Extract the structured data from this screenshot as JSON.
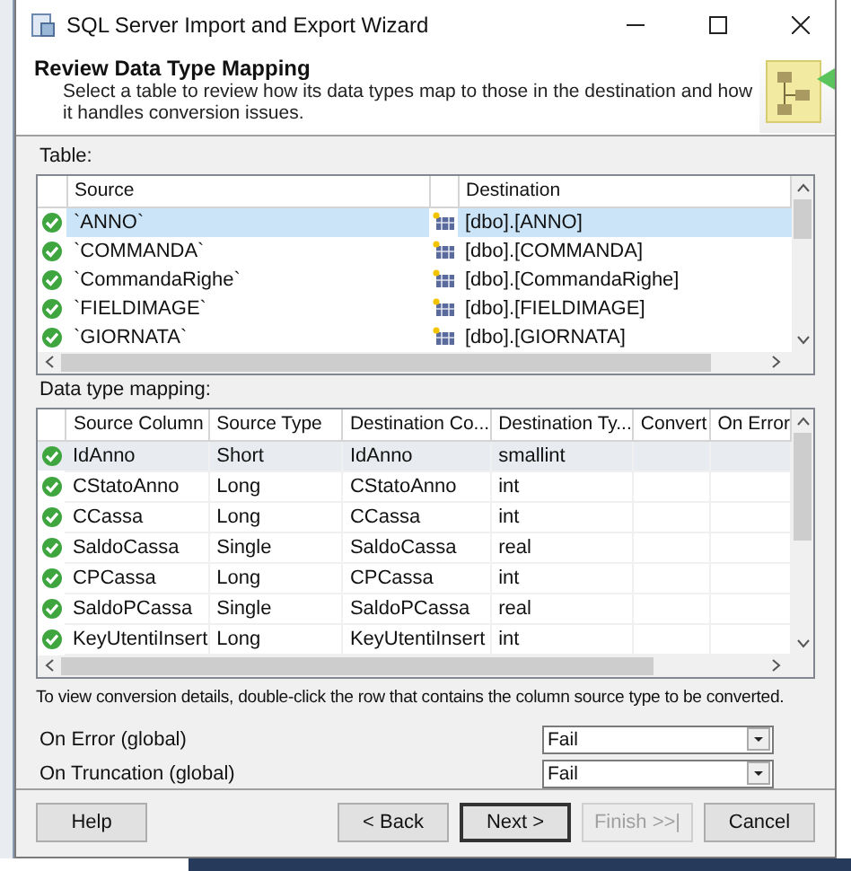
{
  "window": {
    "title": "SQL Server Import and Export Wizard"
  },
  "header": {
    "title": "Review Data Type Mapping",
    "description": "Select a table to review how its data types map to those in the destination and how it handles conversion issues."
  },
  "tables": {
    "label": "Table:",
    "columns": [
      "Source",
      "Destination"
    ],
    "rows": [
      {
        "source": "`ANNO`",
        "destination": "[dbo].[ANNO]",
        "selected": true
      },
      {
        "source": "`COMMANDA`",
        "destination": "[dbo].[COMMANDA]",
        "selected": false
      },
      {
        "source": "`CommandaRighe`",
        "destination": "[dbo].[CommandaRighe]",
        "selected": false
      },
      {
        "source": "`FIELDIMAGE`",
        "destination": "[dbo].[FIELDIMAGE]",
        "selected": false
      },
      {
        "source": "`GIORNATA`",
        "destination": "[dbo].[GIORNATA]",
        "selected": false
      }
    ]
  },
  "mapping": {
    "label": "Data type mapping:",
    "columns": [
      "Source Column",
      "Source Type",
      "Destination Co...",
      "Destination Ty...",
      "Convert",
      "On Error"
    ],
    "rows": [
      {
        "cells": [
          "IdAnno",
          "Short",
          "IdAnno",
          "smallint"
        ],
        "selected": true
      },
      {
        "cells": [
          "CStatoAnno",
          "Long",
          "CStatoAnno",
          "int"
        ],
        "selected": false
      },
      {
        "cells": [
          "CCassa",
          "Long",
          "CCassa",
          "int"
        ],
        "selected": false
      },
      {
        "cells": [
          "SaldoCassa",
          "Single",
          "SaldoCassa",
          "real"
        ],
        "selected": false
      },
      {
        "cells": [
          "CPCassa",
          "Long",
          "CPCassa",
          "int"
        ],
        "selected": false
      },
      {
        "cells": [
          "SaldoPCassa",
          "Single",
          "SaldoPCassa",
          "real"
        ],
        "selected": false
      },
      {
        "cells": [
          "KeyUtentiInsert",
          "Long",
          "KeyUtentiInsert",
          "int"
        ],
        "selected": false
      }
    ]
  },
  "hint": "To view conversion details, double-click the row that contains the column source type to be converted.",
  "options": [
    {
      "label": "On Error (global)",
      "value": "Fail"
    },
    {
      "label": "On Truncation (global)",
      "value": "Fail"
    }
  ],
  "buttons": [
    {
      "label": "Help",
      "disabled": false,
      "default": false
    },
    {
      "label": "< Back",
      "disabled": false,
      "default": false
    },
    {
      "label": "Next >",
      "disabled": false,
      "default": true
    },
    {
      "label": "Finish >>|",
      "disabled": true,
      "default": false
    },
    {
      "label": "Cancel",
      "disabled": false,
      "default": false
    }
  ]
}
